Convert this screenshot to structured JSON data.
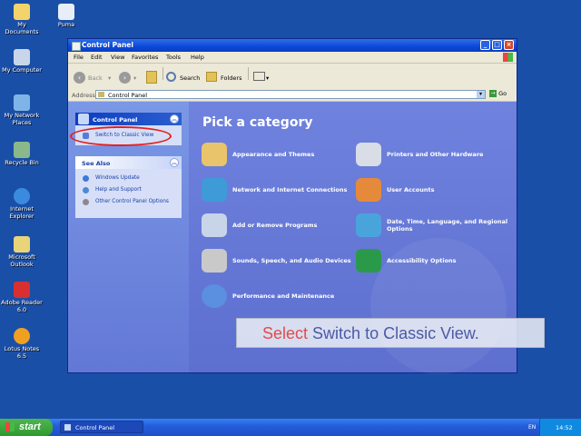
{
  "desktop": {
    "icons": [
      {
        "label": "My Documents",
        "color": "#f3d36a"
      },
      {
        "label": "Puma",
        "color": "#e8eef8"
      },
      {
        "label": "My Computer",
        "color": "#c9d6ea"
      },
      {
        "label": "My Network Places",
        "color": "#7fb4e8"
      },
      {
        "label": "Recycle Bin",
        "color": "#8ab88a"
      },
      {
        "label": "Internet Explorer",
        "color": "#3a8be0"
      },
      {
        "label": "Microsoft Outlook",
        "color": "#e9d47a"
      },
      {
        "label": "Adobe Reader 6.0",
        "color": "#d83030"
      },
      {
        "label": "Lotus Notes 6.5",
        "color": "#f0a020"
      }
    ]
  },
  "window": {
    "title": "Control Panel",
    "menu": [
      "File",
      "Edit",
      "View",
      "Favorites",
      "Tools",
      "Help"
    ],
    "toolbar": {
      "back": "Back",
      "search": "Search",
      "folders": "Folders"
    },
    "address": {
      "label": "Address",
      "value": "Control Panel",
      "go": "Go"
    },
    "controls": {
      "minimize": "_",
      "maximize": "□",
      "close": "×"
    }
  },
  "sidebar": {
    "control_panel": {
      "title": "Control Panel",
      "link": "Switch to Classic View"
    },
    "see_also": {
      "title": "See Also",
      "links": [
        "Windows Update",
        "Help and Support",
        "Other Control Panel Options"
      ]
    }
  },
  "main": {
    "heading": "Pick a category",
    "categories": [
      {
        "label": "Appearance and Themes",
        "icon": "appearance-icon",
        "color": "#e9c46a"
      },
      {
        "label": "Printers and Other Hardware",
        "icon": "printer-icon",
        "color": "#d8dde6"
      },
      {
        "label": "Network and Internet Connections",
        "icon": "network-icon",
        "color": "#3f9ad8"
      },
      {
        "label": "User Accounts",
        "icon": "users-icon",
        "color": "#e58a3a"
      },
      {
        "label": "Add or Remove Programs",
        "icon": "programs-icon",
        "color": "#c8d4e8"
      },
      {
        "label": "Date, Time, Language, and Regional Options",
        "icon": "globe-icon",
        "color": "#4aa4dc"
      },
      {
        "label": "Sounds, Speech, and Audio Devices",
        "icon": "speaker-icon",
        "color": "#c9c9c9"
      },
      {
        "label": "Accessibility Options",
        "icon": "accessibility-icon",
        "color": "#2a9a4a"
      },
      {
        "label": "Performance and Maintenance",
        "icon": "performance-icon",
        "color": "#5b8fe0"
      }
    ]
  },
  "instruction": {
    "word1": "Select",
    "word2": "Switch to Classic View."
  },
  "taskbar": {
    "start": "start",
    "app": "Control Panel",
    "lang": "EN",
    "clock": "14:52"
  },
  "colors": {
    "highlight": "#e32020"
  }
}
